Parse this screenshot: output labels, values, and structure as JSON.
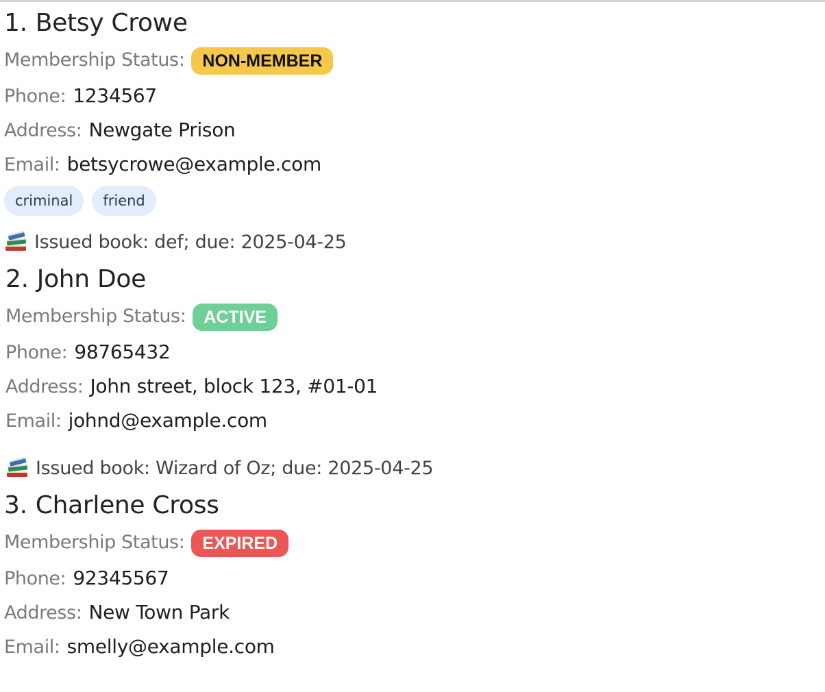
{
  "labels": {
    "membership_status": "Membership Status:",
    "phone": "Phone:",
    "address": "Address:",
    "email": "Email:"
  },
  "colors": {
    "non_member": "#f5c84c",
    "active": "#6fcf97",
    "expired": "#eb5757",
    "tag_bg": "#e3edfb"
  },
  "persons": [
    {
      "index": "1.",
      "name": "Betsy Crowe",
      "status": "NON-MEMBER",
      "phone": "1234567",
      "address": "Newgate Prison",
      "email": "betsycrowe@example.com",
      "tags": [
        "criminal",
        "friend"
      ],
      "book": "Issued book: def; due: 2025-04-25",
      "book_icon": "books-icon"
    },
    {
      "index": "2.",
      "name": "John Doe",
      "status": "ACTIVE",
      "phone": "98765432",
      "address": "John street, block 123, #01-01",
      "email": "johnd@example.com",
      "tags": [],
      "book": "Issued book: Wizard of Oz; due: 2025-04-25",
      "book_icon": "books-icon"
    },
    {
      "index": "3.",
      "name": "Charlene Cross",
      "status": "EXPIRED",
      "phone": "92345567",
      "address": "New Town Park",
      "email": "smelly@example.com",
      "tags": []
    }
  ]
}
